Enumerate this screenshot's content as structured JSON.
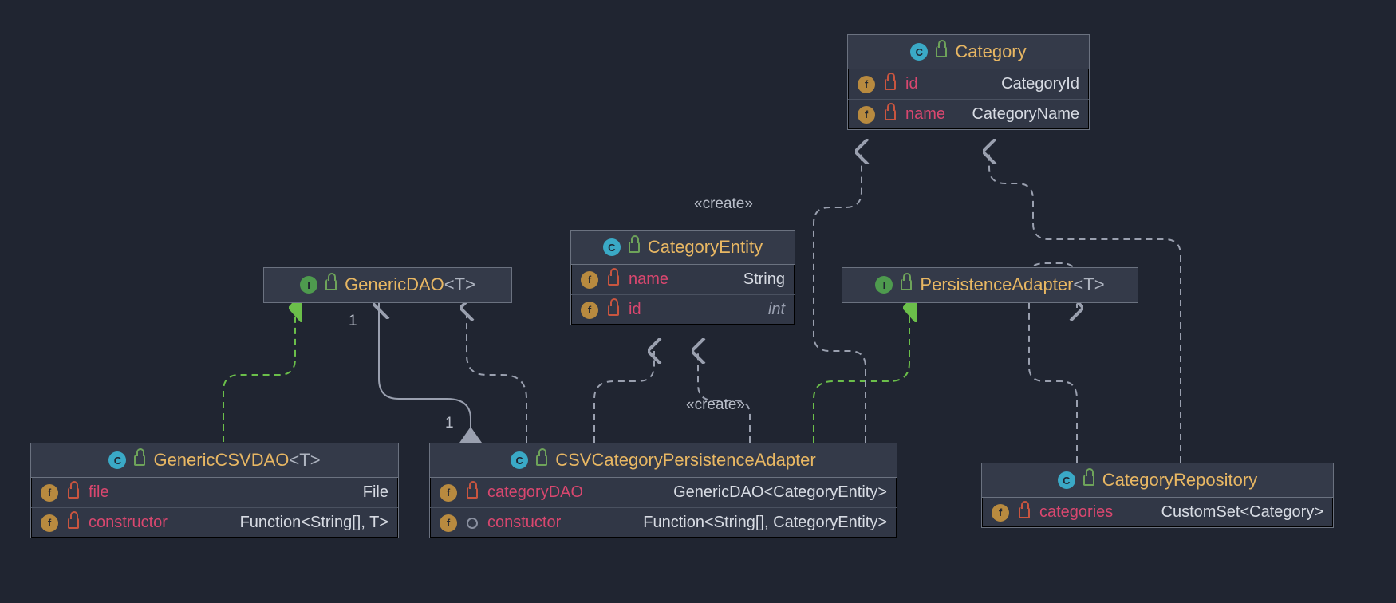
{
  "diagram_type": "UML class diagram",
  "labels": {
    "create1": "«create»",
    "create2": "«create»",
    "mult1": "1",
    "mult2": "1"
  },
  "classes": {
    "category": {
      "kind": "C",
      "name": "Category",
      "fields": [
        {
          "vis": "private",
          "name": "id",
          "type": "CategoryId"
        },
        {
          "vis": "private",
          "name": "name",
          "type": "CategoryName"
        }
      ]
    },
    "genericDAO": {
      "kind": "I",
      "name": "GenericDAO",
      "tparam": "<T>"
    },
    "categoryEntity": {
      "kind": "C",
      "name": "CategoryEntity",
      "fields": [
        {
          "vis": "private",
          "name": "name",
          "type": "String"
        },
        {
          "vis": "private",
          "name": "id",
          "type": "int",
          "italic": true
        }
      ]
    },
    "persistenceAdapter": {
      "kind": "I",
      "name": "PersistenceAdapter",
      "tparam": "<T>"
    },
    "genericCSVDAO": {
      "kind": "C",
      "name": "GenericCSVDAO",
      "tparam": "<T>",
      "fields": [
        {
          "vis": "private",
          "name": "file",
          "type": "File"
        },
        {
          "vis": "private",
          "name": "constructor",
          "type": "Function<String[], T>"
        }
      ]
    },
    "csvCategoryPersistenceAdapter": {
      "kind": "C",
      "name": "CSVCategoryPersistenceAdapter",
      "fields": [
        {
          "vis": "private",
          "name": "categoryDAO",
          "type": "GenericDAO<CategoryEntity>"
        },
        {
          "vis": "package",
          "name": "constuctor",
          "type": "Function<String[], CategoryEntity>"
        }
      ]
    },
    "categoryRepository": {
      "kind": "C",
      "name": "CategoryRepository",
      "fields": [
        {
          "vis": "private",
          "name": "categories",
          "type": "CustomSet<Category>"
        }
      ]
    }
  },
  "relations": [
    {
      "from": "genericCSVDAO",
      "to": "genericDAO",
      "type": "realization"
    },
    {
      "from": "csvCategoryPersistenceAdapter",
      "to": "genericDAO",
      "type": "aggregation",
      "from_mult": "1",
      "to_mult": "1"
    },
    {
      "from": "csvCategoryPersistenceAdapter",
      "to": "categoryEntity",
      "type": "dependency"
    },
    {
      "from": "csvCategoryPersistenceAdapter",
      "to": "categoryEntity",
      "type": "dependency",
      "label": "«create»"
    },
    {
      "from": "csvCategoryPersistenceAdapter",
      "to": "persistenceAdapter",
      "type": "realization"
    },
    {
      "from": "csvCategoryPersistenceAdapter",
      "to": "category",
      "type": "dependency",
      "label": "«create»"
    },
    {
      "from": "categoryRepository",
      "to": "persistenceAdapter",
      "type": "dependency"
    },
    {
      "from": "categoryRepository",
      "to": "category",
      "type": "dependency"
    }
  ]
}
